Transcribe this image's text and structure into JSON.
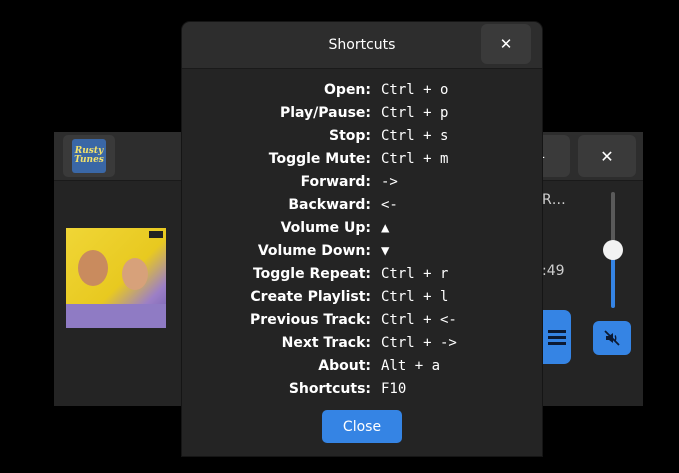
{
  "player": {
    "logo_text": "Rusty Tunes",
    "minimize_label": "–",
    "close_label": "✕",
    "track_title": "R…",
    "track_time": ":49"
  },
  "dialog": {
    "title": "Shortcuts",
    "close_icon": "✕",
    "close_button": "Close",
    "shortcuts": [
      {
        "label": "Open:",
        "keys": "Ctrl + o"
      },
      {
        "label": "Play/Pause:",
        "keys": "Ctrl + p"
      },
      {
        "label": "Stop:",
        "keys": "Ctrl + s"
      },
      {
        "label": "Toggle Mute:",
        "keys": "Ctrl + m"
      },
      {
        "label": "Forward:",
        "keys": "->"
      },
      {
        "label": "Backward:",
        "keys": "<-"
      },
      {
        "label": "Volume Up:",
        "keys": "▲"
      },
      {
        "label": "Volume Down:",
        "keys": "▼"
      },
      {
        "label": "Toggle Repeat:",
        "keys": "Ctrl + r"
      },
      {
        "label": "Create Playlist:",
        "keys": "Ctrl + l"
      },
      {
        "label": "Previous Track:",
        "keys": "Ctrl + <-"
      },
      {
        "label": "Next Track:",
        "keys": "Ctrl + ->"
      },
      {
        "label": "About:",
        "keys": "Alt + a"
      },
      {
        "label": "Shortcuts:",
        "keys": "F10"
      }
    ]
  },
  "icons": {
    "queue": "queue-icon",
    "mute": "mute-icon",
    "close": "close-icon"
  },
  "colors": {
    "accent": "#3584e4",
    "window_bg": "#242424",
    "header_bg": "#2d2d2d"
  }
}
